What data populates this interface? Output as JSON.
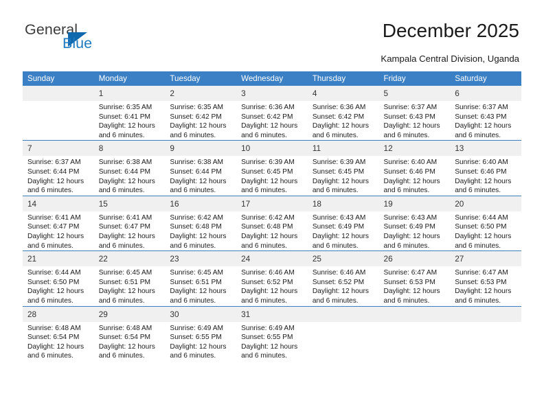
{
  "brand": {
    "name_part1": "General",
    "name_part2": "Blue",
    "accent_color": "#1068ad"
  },
  "header": {
    "title": "December 2025",
    "location": "Kampala Central Division, Uganda",
    "header_bg_color": "#3b7fc4"
  },
  "weekdays": [
    "Sunday",
    "Monday",
    "Tuesday",
    "Wednesday",
    "Thursday",
    "Friday",
    "Saturday"
  ],
  "labels": {
    "sunrise_prefix": "Sunrise: ",
    "sunset_prefix": "Sunset: ",
    "daylight_prefix": "Daylight: "
  },
  "weeks": [
    [
      {
        "day": "",
        "sunrise": "",
        "sunset": "",
        "daylight_line1": "",
        "daylight_line2": ""
      },
      {
        "day": "1",
        "sunrise": "Sunrise: 6:35 AM",
        "sunset": "Sunset: 6:41 PM",
        "daylight_line1": "Daylight: 12 hours",
        "daylight_line2": "and 6 minutes."
      },
      {
        "day": "2",
        "sunrise": "Sunrise: 6:35 AM",
        "sunset": "Sunset: 6:42 PM",
        "daylight_line1": "Daylight: 12 hours",
        "daylight_line2": "and 6 minutes."
      },
      {
        "day": "3",
        "sunrise": "Sunrise: 6:36 AM",
        "sunset": "Sunset: 6:42 PM",
        "daylight_line1": "Daylight: 12 hours",
        "daylight_line2": "and 6 minutes."
      },
      {
        "day": "4",
        "sunrise": "Sunrise: 6:36 AM",
        "sunset": "Sunset: 6:42 PM",
        "daylight_line1": "Daylight: 12 hours",
        "daylight_line2": "and 6 minutes."
      },
      {
        "day": "5",
        "sunrise": "Sunrise: 6:37 AM",
        "sunset": "Sunset: 6:43 PM",
        "daylight_line1": "Daylight: 12 hours",
        "daylight_line2": "and 6 minutes."
      },
      {
        "day": "6",
        "sunrise": "Sunrise: 6:37 AM",
        "sunset": "Sunset: 6:43 PM",
        "daylight_line1": "Daylight: 12 hours",
        "daylight_line2": "and 6 minutes."
      }
    ],
    [
      {
        "day": "7",
        "sunrise": "Sunrise: 6:37 AM",
        "sunset": "Sunset: 6:44 PM",
        "daylight_line1": "Daylight: 12 hours",
        "daylight_line2": "and 6 minutes."
      },
      {
        "day": "8",
        "sunrise": "Sunrise: 6:38 AM",
        "sunset": "Sunset: 6:44 PM",
        "daylight_line1": "Daylight: 12 hours",
        "daylight_line2": "and 6 minutes."
      },
      {
        "day": "9",
        "sunrise": "Sunrise: 6:38 AM",
        "sunset": "Sunset: 6:44 PM",
        "daylight_line1": "Daylight: 12 hours",
        "daylight_line2": "and 6 minutes."
      },
      {
        "day": "10",
        "sunrise": "Sunrise: 6:39 AM",
        "sunset": "Sunset: 6:45 PM",
        "daylight_line1": "Daylight: 12 hours",
        "daylight_line2": "and 6 minutes."
      },
      {
        "day": "11",
        "sunrise": "Sunrise: 6:39 AM",
        "sunset": "Sunset: 6:45 PM",
        "daylight_line1": "Daylight: 12 hours",
        "daylight_line2": "and 6 minutes."
      },
      {
        "day": "12",
        "sunrise": "Sunrise: 6:40 AM",
        "sunset": "Sunset: 6:46 PM",
        "daylight_line1": "Daylight: 12 hours",
        "daylight_line2": "and 6 minutes."
      },
      {
        "day": "13",
        "sunrise": "Sunrise: 6:40 AM",
        "sunset": "Sunset: 6:46 PM",
        "daylight_line1": "Daylight: 12 hours",
        "daylight_line2": "and 6 minutes."
      }
    ],
    [
      {
        "day": "14",
        "sunrise": "Sunrise: 6:41 AM",
        "sunset": "Sunset: 6:47 PM",
        "daylight_line1": "Daylight: 12 hours",
        "daylight_line2": "and 6 minutes."
      },
      {
        "day": "15",
        "sunrise": "Sunrise: 6:41 AM",
        "sunset": "Sunset: 6:47 PM",
        "daylight_line1": "Daylight: 12 hours",
        "daylight_line2": "and 6 minutes."
      },
      {
        "day": "16",
        "sunrise": "Sunrise: 6:42 AM",
        "sunset": "Sunset: 6:48 PM",
        "daylight_line1": "Daylight: 12 hours",
        "daylight_line2": "and 6 minutes."
      },
      {
        "day": "17",
        "sunrise": "Sunrise: 6:42 AM",
        "sunset": "Sunset: 6:48 PM",
        "daylight_line1": "Daylight: 12 hours",
        "daylight_line2": "and 6 minutes."
      },
      {
        "day": "18",
        "sunrise": "Sunrise: 6:43 AM",
        "sunset": "Sunset: 6:49 PM",
        "daylight_line1": "Daylight: 12 hours",
        "daylight_line2": "and 6 minutes."
      },
      {
        "day": "19",
        "sunrise": "Sunrise: 6:43 AM",
        "sunset": "Sunset: 6:49 PM",
        "daylight_line1": "Daylight: 12 hours",
        "daylight_line2": "and 6 minutes."
      },
      {
        "day": "20",
        "sunrise": "Sunrise: 6:44 AM",
        "sunset": "Sunset: 6:50 PM",
        "daylight_line1": "Daylight: 12 hours",
        "daylight_line2": "and 6 minutes."
      }
    ],
    [
      {
        "day": "21",
        "sunrise": "Sunrise: 6:44 AM",
        "sunset": "Sunset: 6:50 PM",
        "daylight_line1": "Daylight: 12 hours",
        "daylight_line2": "and 6 minutes."
      },
      {
        "day": "22",
        "sunrise": "Sunrise: 6:45 AM",
        "sunset": "Sunset: 6:51 PM",
        "daylight_line1": "Daylight: 12 hours",
        "daylight_line2": "and 6 minutes."
      },
      {
        "day": "23",
        "sunrise": "Sunrise: 6:45 AM",
        "sunset": "Sunset: 6:51 PM",
        "daylight_line1": "Daylight: 12 hours",
        "daylight_line2": "and 6 minutes."
      },
      {
        "day": "24",
        "sunrise": "Sunrise: 6:46 AM",
        "sunset": "Sunset: 6:52 PM",
        "daylight_line1": "Daylight: 12 hours",
        "daylight_line2": "and 6 minutes."
      },
      {
        "day": "25",
        "sunrise": "Sunrise: 6:46 AM",
        "sunset": "Sunset: 6:52 PM",
        "daylight_line1": "Daylight: 12 hours",
        "daylight_line2": "and 6 minutes."
      },
      {
        "day": "26",
        "sunrise": "Sunrise: 6:47 AM",
        "sunset": "Sunset: 6:53 PM",
        "daylight_line1": "Daylight: 12 hours",
        "daylight_line2": "and 6 minutes."
      },
      {
        "day": "27",
        "sunrise": "Sunrise: 6:47 AM",
        "sunset": "Sunset: 6:53 PM",
        "daylight_line1": "Daylight: 12 hours",
        "daylight_line2": "and 6 minutes."
      }
    ],
    [
      {
        "day": "28",
        "sunrise": "Sunrise: 6:48 AM",
        "sunset": "Sunset: 6:54 PM",
        "daylight_line1": "Daylight: 12 hours",
        "daylight_line2": "and 6 minutes."
      },
      {
        "day": "29",
        "sunrise": "Sunrise: 6:48 AM",
        "sunset": "Sunset: 6:54 PM",
        "daylight_line1": "Daylight: 12 hours",
        "daylight_line2": "and 6 minutes."
      },
      {
        "day": "30",
        "sunrise": "Sunrise: 6:49 AM",
        "sunset": "Sunset: 6:55 PM",
        "daylight_line1": "Daylight: 12 hours",
        "daylight_line2": "and 6 minutes."
      },
      {
        "day": "31",
        "sunrise": "Sunrise: 6:49 AM",
        "sunset": "Sunset: 6:55 PM",
        "daylight_line1": "Daylight: 12 hours",
        "daylight_line2": "and 6 minutes."
      },
      {
        "day": "",
        "sunrise": "",
        "sunset": "",
        "daylight_line1": "",
        "daylight_line2": ""
      },
      {
        "day": "",
        "sunrise": "",
        "sunset": "",
        "daylight_line1": "",
        "daylight_line2": ""
      },
      {
        "day": "",
        "sunrise": "",
        "sunset": "",
        "daylight_line1": "",
        "daylight_line2": ""
      }
    ]
  ]
}
